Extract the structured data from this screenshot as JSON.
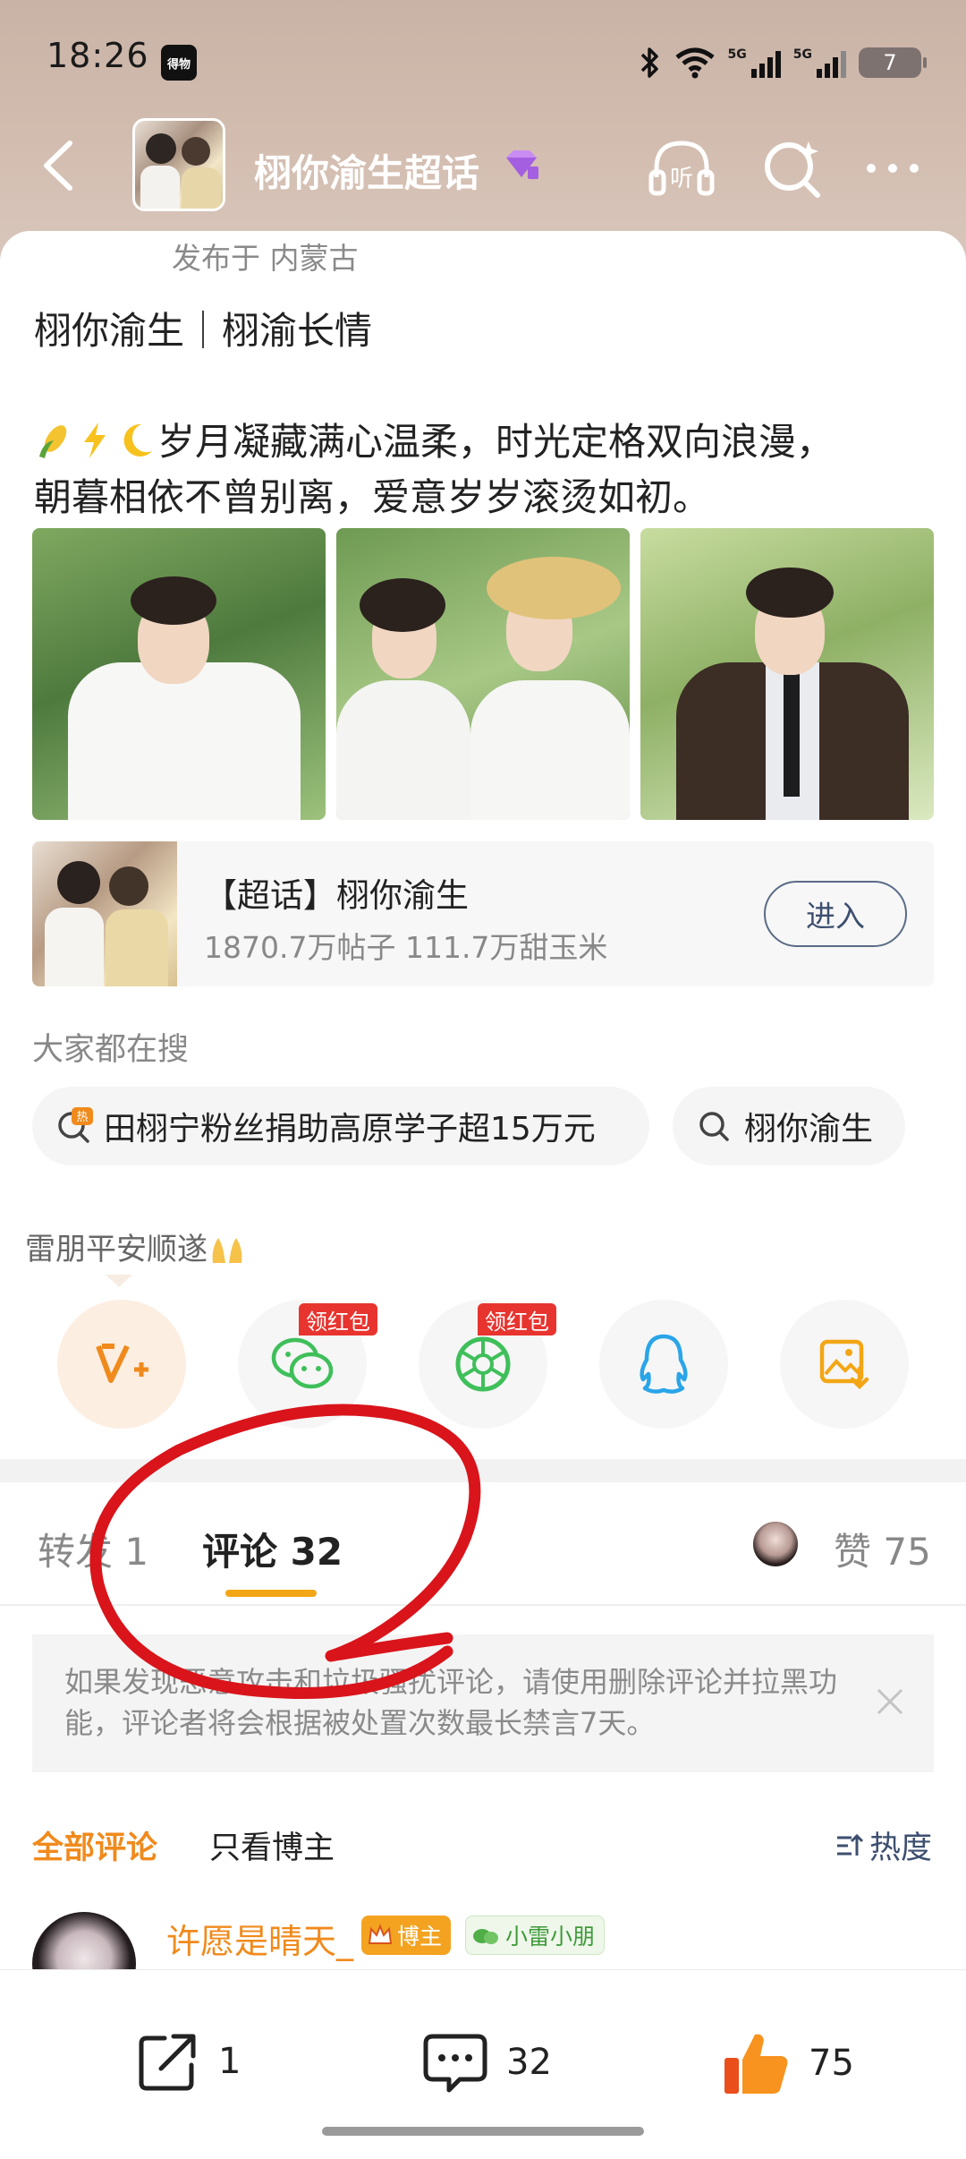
{
  "status": {
    "time": "18:26",
    "app_icon_text": "得物",
    "network1": "5G",
    "network2": "5G",
    "battery": "7"
  },
  "header": {
    "topic_title": "栩你渝生超话",
    "listen_label": "听"
  },
  "post": {
    "location": "发布于 内蒙古",
    "line1": "栩你渝生｜栩渝长情",
    "line2": "岁月凝藏满心温柔，时光定格双向浪漫，",
    "line3": "朝暮相依不曾别离，爱意岁岁滚烫如初。"
  },
  "topic_card": {
    "title": "【超话】栩你渝生",
    "stats": "1870.7万帖子 111.7万甜玉米",
    "enter_label": "进入"
  },
  "search": {
    "label": "大家都在搜",
    "chip1": "田栩宁粉丝捐助高原学子超15万元",
    "chip1_badge": "热",
    "chip2": "栩你渝生"
  },
  "hint": {
    "text": "雷朋平安顺遂"
  },
  "share": {
    "redpack_label": "领红包"
  },
  "tabs": {
    "repost": "转发 1",
    "comment": "评论 32",
    "like": "赞 75"
  },
  "notice": {
    "text": "如果发现恶意攻击和垃圾骚扰评论，请使用删除评论并拉黑功能，评论者将会根据被处置次数最长禁言7天。"
  },
  "filters": {
    "all": "全部评论",
    "author_only": "只看博主",
    "sort": "热度"
  },
  "comment": {
    "name": "许愿是晴天_",
    "badge_blogger": "博主",
    "badge_fan": "小雷小朋"
  },
  "bottom_bar": {
    "repost_count": "1",
    "comment_count": "32",
    "like_count": "75"
  },
  "colors": {
    "accent_orange": "#f08a1c",
    "tab_underline": "#f3a615",
    "redpack": "#e8342f",
    "annotation_red": "#d9141b"
  }
}
